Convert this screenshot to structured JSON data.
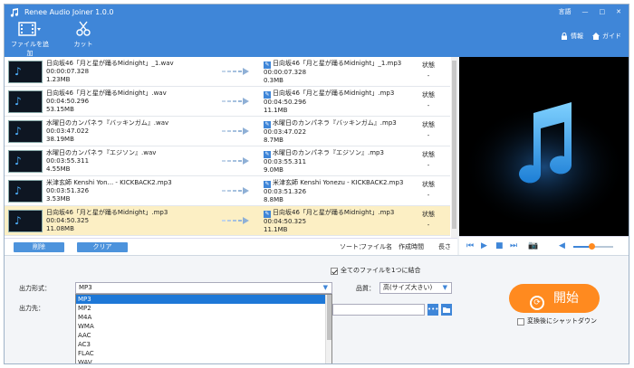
{
  "window": {
    "title": "Renee Audio Joiner 1.0.0",
    "language": "言語",
    "controls": [
      "—",
      "□",
      "✕"
    ]
  },
  "toolbar": {
    "add_file": "ファイルを追加",
    "cut": "カット",
    "info": "情報",
    "guide": "ガイド"
  },
  "files": [
    {
      "name": "日向坂46「月と星が踊るMidnight」_1.wav",
      "duration": "00:00:07.328",
      "size": "1.23MB",
      "out_name": "日向坂46「月と星が踊るMidnight」_1.mp3",
      "out_duration": "00:00:07.328",
      "out_size": "0.3MB",
      "status_label": "状態",
      "status": "-",
      "selected": false
    },
    {
      "name": "日向坂46「月と星が踊るMidnight」.wav",
      "duration": "00:04:50.296",
      "size": "53.15MB",
      "out_name": "日向坂46「月と星が踊るMidnight」.mp3",
      "out_duration": "00:04:50.296",
      "out_size": "11.1MB",
      "status_label": "状態",
      "status": "-",
      "selected": false
    },
    {
      "name": "水曜日のカンパネラ『バッキンガム』.wav",
      "duration": "00:03:47.022",
      "size": "38.19MB",
      "out_name": "水曜日のカンパネラ『バッキンガム』.mp3",
      "out_duration": "00:03:47.022",
      "out_size": "8.7MB",
      "status_label": "状態",
      "status": "-",
      "selected": false
    },
    {
      "name": "水曜日のカンパネラ『エジソン』.wav",
      "duration": "00:03:55.311",
      "size": "4.55MB",
      "out_name": "水曜日のカンパネラ『エジソン』.mp3",
      "out_duration": "00:03:55.311",
      "out_size": "9.0MB",
      "status_label": "状態",
      "status": "-",
      "selected": false
    },
    {
      "name": "米津玄師 Kenshi Yon... - KICKBACK2.mp3",
      "duration": "00:03:51.326",
      "size": "3.53MB",
      "out_name": "米津玄師 Kenshi Yonezu - KICKBACK2.mp3",
      "out_duration": "00:03:51.326",
      "out_size": "8.8MB",
      "status_label": "状態",
      "status": "-",
      "selected": false
    },
    {
      "name": "日向坂46「月と星が踊るMidnight」.mp3",
      "duration": "00:04:50.325",
      "size": "11.08MB",
      "out_name": "日向坂46「月と星が踊るMidnight」.mp3",
      "out_duration": "00:04:50.325",
      "out_size": "11.1MB",
      "status_label": "状態",
      "status": "-",
      "selected": true
    }
  ],
  "list_actions": {
    "delete": "削除",
    "clear": "クリア",
    "sort_label": "ソート：",
    "sort_options": [
      "ファイル名",
      "作成時間",
      "長さ"
    ]
  },
  "settings": {
    "merge_all": "全てのファイルを1つに結合",
    "merge_checked": true,
    "format_label": "出力形式：",
    "format_value": "MP3",
    "format_options": [
      "MP3",
      "MP2",
      "M4A",
      "WMA",
      "AAC",
      "AC3",
      "FLAC",
      "WAV"
    ],
    "quality_label": "品質：",
    "quality_value": "高(サイズ大きい)",
    "output_label": "出力先：",
    "start": "開始",
    "shutdown": "変換後にシャットダウン",
    "shutdown_checked": false
  },
  "colors": {
    "accent": "#3f86d8",
    "start_button": "#ff8a1f",
    "selected_row": "#fcefc4"
  },
  "player": {
    "volume": 0.45
  }
}
